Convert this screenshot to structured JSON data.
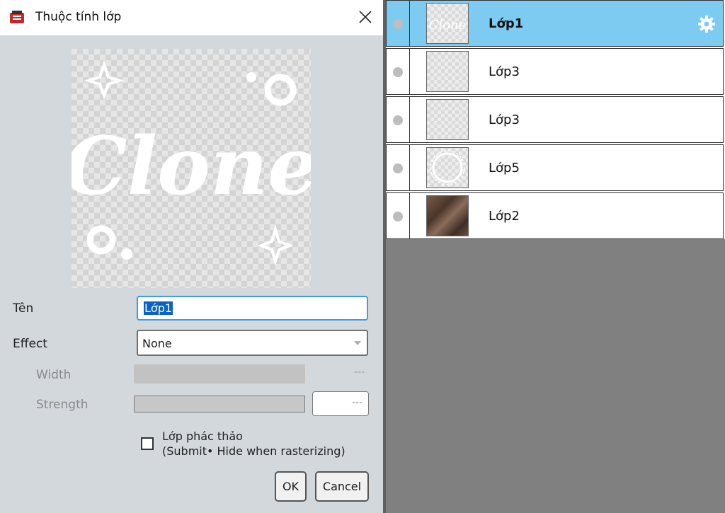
{
  "dialog": {
    "title": "Thuộc tính lớp",
    "preview_text": "Clone",
    "name_label": "Tên",
    "name_value": "Lớp1",
    "effect_label": "Effect",
    "effect_value": "None",
    "width_label": "Width",
    "width_value": "---",
    "strength_label": "Strength",
    "strength_value": "---",
    "draft_checkbox_line1": "Lớp phác thảo",
    "draft_checkbox_line2": "(Submit• Hide when rasterizing)",
    "draft_checked": false,
    "ok_label": "OK",
    "cancel_label": "Cancel"
  },
  "layers": [
    {
      "name": "Lớp1",
      "active": true,
      "thumb": "clone-text"
    },
    {
      "name": "Lớp3",
      "active": false,
      "thumb": "transparent"
    },
    {
      "name": "Lớp3",
      "active": false,
      "thumb": "transparent"
    },
    {
      "name": "Lớp5",
      "active": false,
      "thumb": "circle-frame"
    },
    {
      "name": "Lớp2",
      "active": false,
      "thumb": "photo"
    }
  ],
  "colors": {
    "active_layer": "#7ecbf2",
    "selection": "#0a64c8",
    "focus_border": "#3c9ee8",
    "panel_bg": "#d3d8dc",
    "workspace": "#808080"
  }
}
